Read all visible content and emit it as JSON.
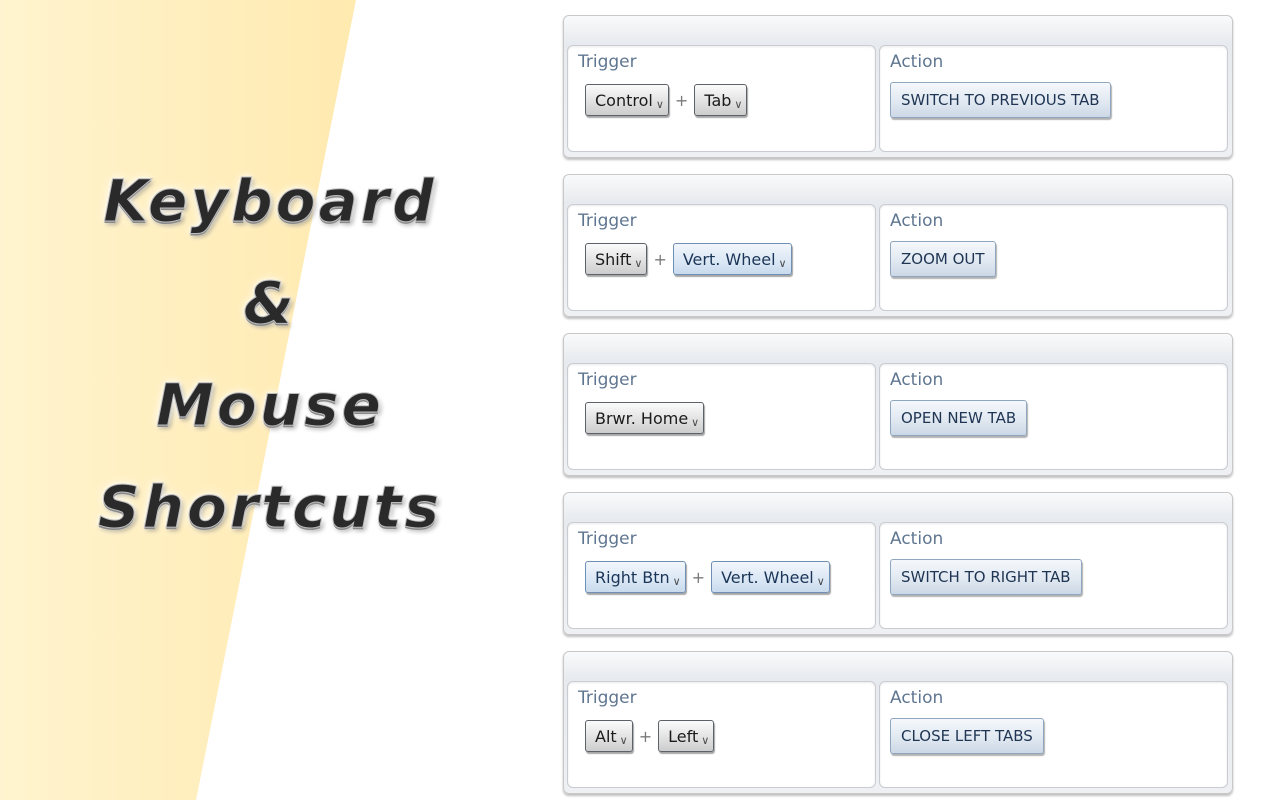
{
  "title": {
    "line1": "Keyboard",
    "line2": "&",
    "line3": "Mouse",
    "line4": "Shortcuts"
  },
  "colors": {
    "panel_gradient_start": "#fff4cf",
    "panel_gradient_end": "#fad383",
    "label_color": "#5f7690",
    "action_text": "#1f3553"
  },
  "shortcuts": [
    {
      "trigger_label": "Trigger",
      "action_label": "Action",
      "key1": "Control",
      "plus": "+",
      "key2": "Tab",
      "action": "SWITCH TO PREVIOUS TAB"
    },
    {
      "trigger_label": "Trigger",
      "action_label": "Action",
      "key1": "Shift",
      "plus": "+",
      "key2": "Vert. Wheel",
      "action": "ZOOM OUT"
    },
    {
      "trigger_label": "Trigger",
      "action_label": "Action",
      "key1": "Brwr. Home",
      "action": "OPEN NEW TAB"
    },
    {
      "trigger_label": "Trigger",
      "action_label": "Action",
      "key1": "Right Btn",
      "plus": "+",
      "key2": "Vert. Wheel",
      "action": "SWITCH TO RIGHT TAB"
    },
    {
      "trigger_label": "Trigger",
      "action_label": "Action",
      "key1": "Alt",
      "plus": "+",
      "key2": "Left",
      "action": "CLOSE LEFT TABS"
    }
  ],
  "icons": {
    "dropdown": "chevron-down-icon",
    "dropdown_glyph": "∨"
  }
}
